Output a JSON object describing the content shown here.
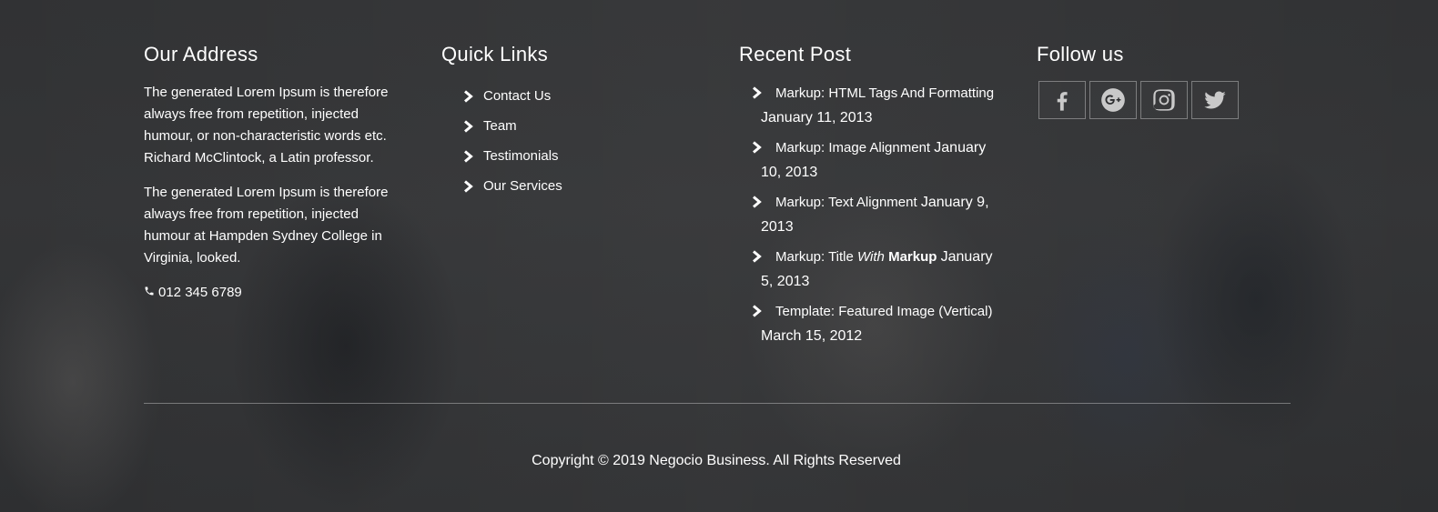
{
  "address": {
    "heading": "Our Address",
    "para1": "The generated Lorem Ipsum is therefore always free from repetition, injected humour, or non-characteristic words etc. Richard McClintock, a Latin professor.",
    "para2": "The generated Lorem Ipsum is therefore always free from repetition, injected humour at Hampden Sydney College in Virginia, looked.",
    "phone": "012 345 6789",
    "phone_icon": "phone-icon"
  },
  "quick_links": {
    "heading": "Quick Links",
    "items": [
      {
        "label": "Contact Us"
      },
      {
        "label": "Team"
      },
      {
        "label": "Testimonials"
      },
      {
        "label": "Our Services"
      }
    ]
  },
  "recent_post": {
    "heading": "Recent Post",
    "items": [
      {
        "title": "Markup: HTML Tags And Formatting",
        "date": "January 11, 2013"
      },
      {
        "title": "Markup: Image Alignment",
        "date": "January 10, 2013"
      },
      {
        "title": "Markup: Text Alignment",
        "date": "January 9, 2013"
      },
      {
        "title_prefix": "Markup: Title ",
        "title_em": "With",
        "title_strong": "Markup",
        "date": "January 5, 2013"
      },
      {
        "title": "Template: Featured Image (Vertical)",
        "date": "March 15, 2012"
      }
    ]
  },
  "follow": {
    "heading": "Follow us",
    "icons": [
      "facebook-icon",
      "google-plus-icon",
      "instagram-icon",
      "twitter-icon"
    ]
  },
  "copyright": "Copyright © 2019 Negocio Business. All Rights Reserved",
  "colors": {
    "text": "#ffffff",
    "icon": "#c9c9c9",
    "background": "#2c2d2f"
  }
}
